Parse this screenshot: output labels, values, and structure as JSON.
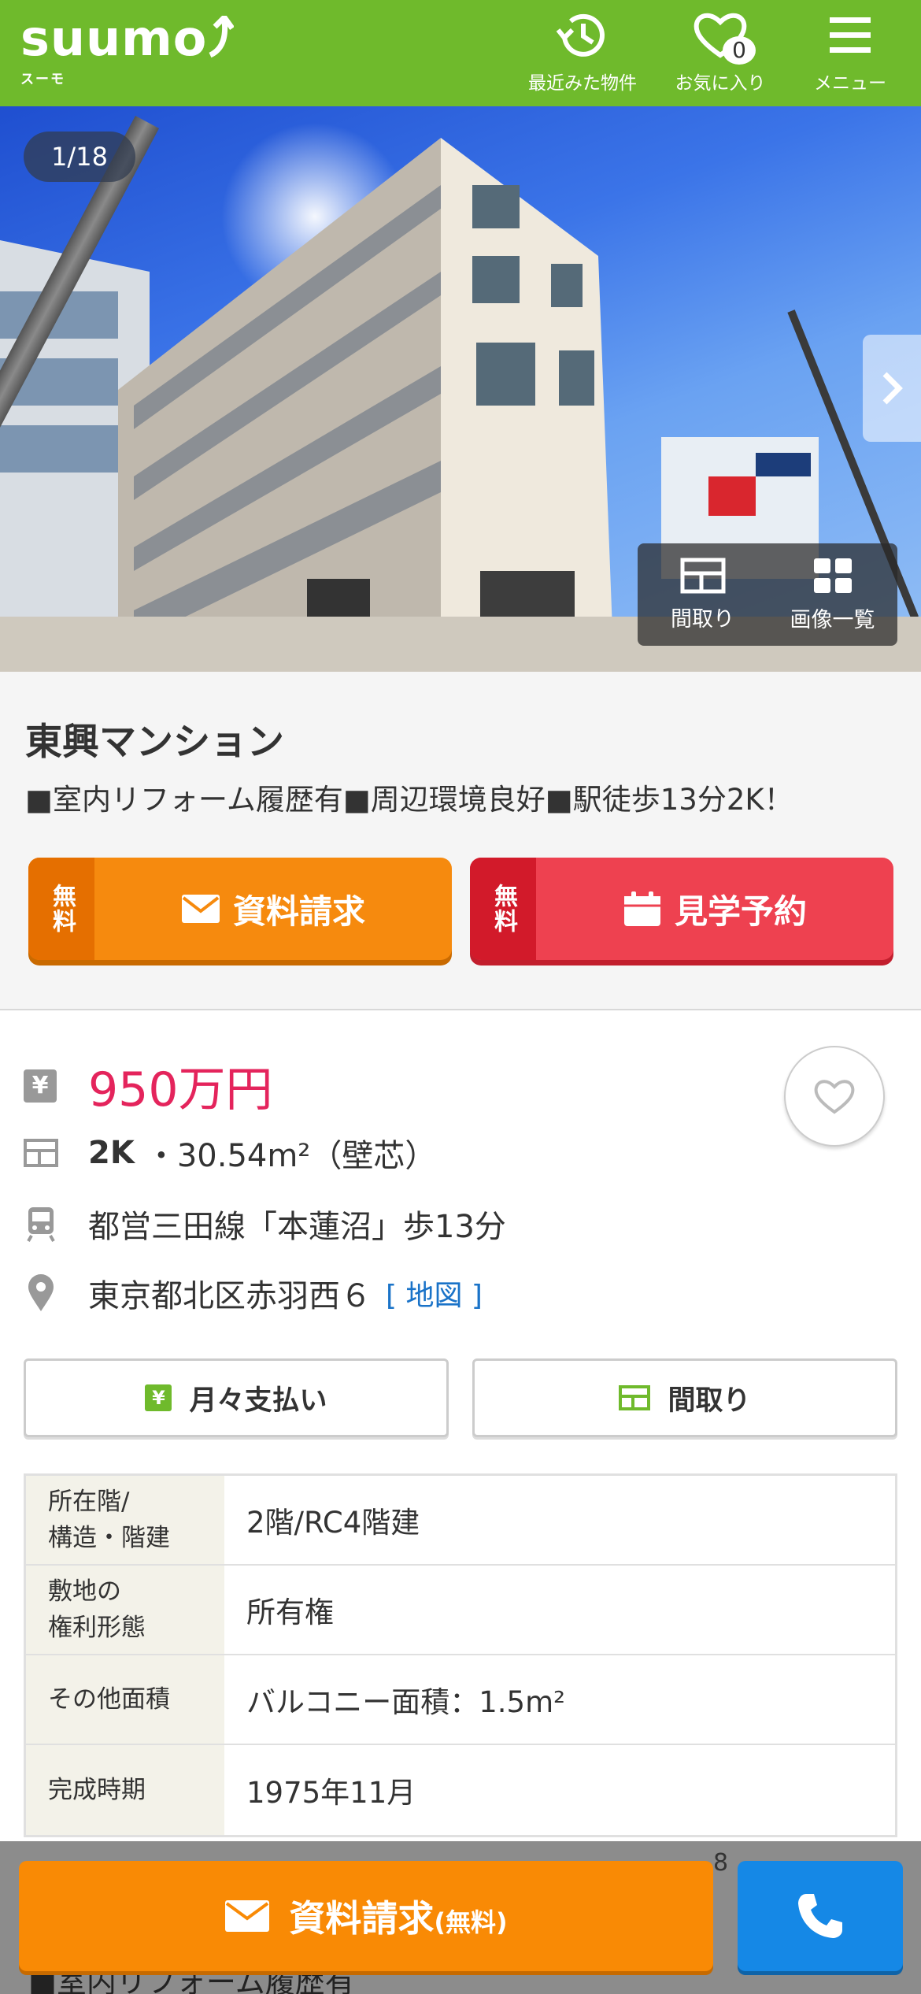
{
  "header": {
    "logo_text": "suumo",
    "logo_sub": "スーモ",
    "nav_recent_label": "最近みた物件",
    "nav_fav_label": "お気に入り",
    "fav_count": "0",
    "nav_menu_label": "メニュー"
  },
  "photo": {
    "counter": "1/18",
    "tool_floorplan_label": "間取り",
    "tool_gallery_label": "画像一覧"
  },
  "property": {
    "name": "東興マンション",
    "catch_copy": "■室内リフォーム履歴有■周辺環境良好■駅徒歩13分2K！"
  },
  "cta": {
    "free_label": "無料",
    "doc_label": "資料請求",
    "visit_label": "見学予約"
  },
  "info": {
    "price": "950万円",
    "layout": "2K",
    "area": "・30.54m²（壁芯）",
    "access": "都営三田線「本蓮沼」歩13分",
    "address": "東京都北区赤羽西６",
    "map_link": "[ 地図 ]"
  },
  "tabs": {
    "payment_label": "月々支払い",
    "layout_label": "間取り"
  },
  "spec": [
    {
      "label": "所在階/\n構造・階建",
      "value": "2階/RC4階建"
    },
    {
      "label": "敷地の\n権利形態",
      "value": "所有権"
    },
    {
      "label": "その他面積",
      "value": "バルコニー面積：1.5m²"
    },
    {
      "label": "完成時期",
      "value": "1975年11月"
    }
  ],
  "footer": {
    "doc_label": "資料請求",
    "doc_free": "(無料)",
    "behind_text": "■室内リフォーム履歴有",
    "behind_num": "8"
  },
  "colors": {
    "brand_green": "#6fba2c",
    "price_pink": "#e4245c",
    "cta_orange": "#f68a0e",
    "cta_red": "#ee4150",
    "call_blue": "#1588e6",
    "link_blue": "#1a73c8"
  }
}
